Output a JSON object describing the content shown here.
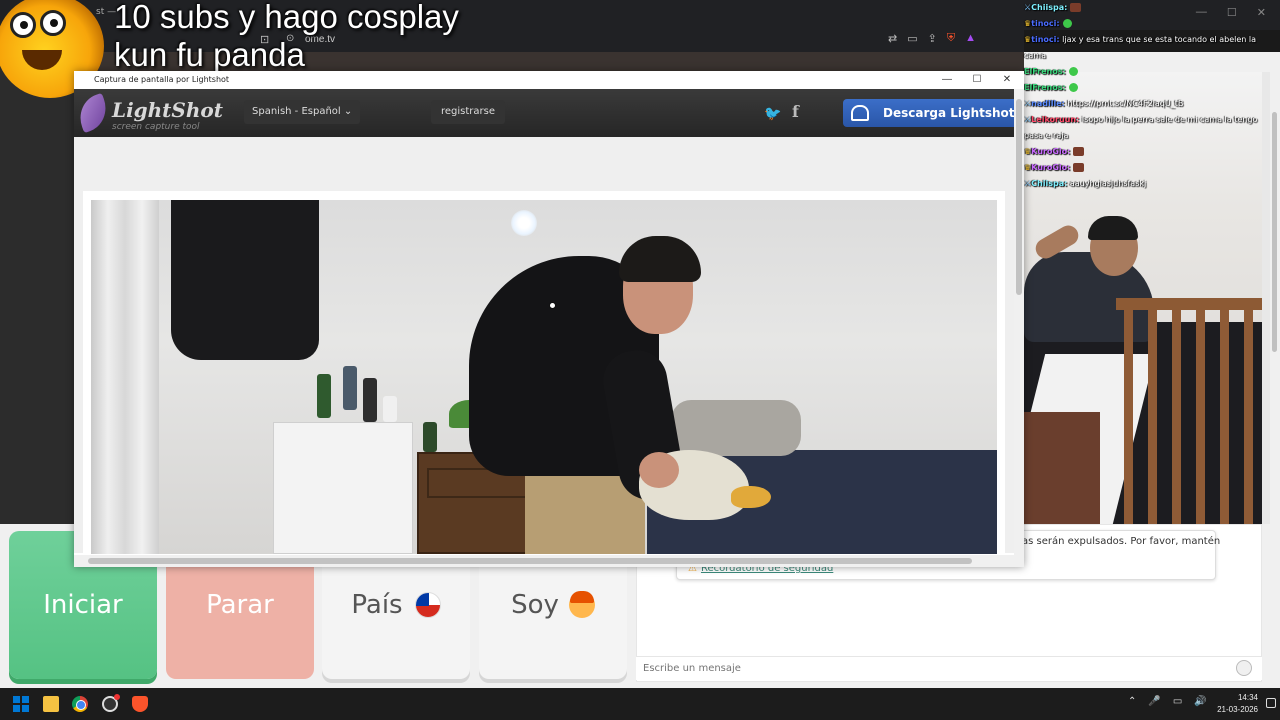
{
  "browser": {
    "tab_text": "st —",
    "url": "ome.tv",
    "window_controls": [
      "—",
      "☐",
      "✕"
    ],
    "address_icons": [
      "⇄",
      "▭",
      "⇪",
      "⋯"
    ]
  },
  "stream_overlay": {
    "title_line1": "10 subs y hago cosplay",
    "title_line2": "kun fu panda"
  },
  "stream_chat": [
    {
      "badge": "⚔",
      "badge_type": "sword",
      "user": "Chiispa:",
      "user_color": "#7ef0ff",
      "text": "",
      "emote": "brown"
    },
    {
      "badge": "♛",
      "badge_type": "crown",
      "user": "tinoci:",
      "user_color": "#4a6cff",
      "text": "",
      "emote": "green"
    },
    {
      "badge": "♛",
      "badge_type": "crown",
      "user": "tinoci:",
      "user_color": "#4a6cff",
      "text": "ljax y esa trans que se esta tocando el abelen la cama",
      "emote": ""
    },
    {
      "badge": "",
      "badge_type": "",
      "user": "ElFrenos:",
      "user_color": "#3ad87c",
      "text": "",
      "emote": "green"
    },
    {
      "badge": "",
      "badge_type": "",
      "user": "ElFrenos:",
      "user_color": "#3ad87c",
      "text": "",
      "emote": "green"
    },
    {
      "badge": "⚔",
      "badge_type": "sword",
      "user": "nadille:",
      "user_color": "#5a8cff",
      "text": "https://prnt.sc/NC4F2iaqU_tB",
      "emote": ""
    },
    {
      "badge": "⚔",
      "badge_type": "sword",
      "user": "Leikoruun:",
      "user_color": "#ff4a6a",
      "text": "isopo hijo la perra sale de mi cama la tengo pasa e raja",
      "emote": ""
    },
    {
      "badge": "♛",
      "badge_type": "crown",
      "user": "KuroGio:",
      "user_color": "#c86aff",
      "text": "",
      "emote": "brown"
    },
    {
      "badge": "♛",
      "badge_type": "crown",
      "user": "KuroGio:",
      "user_color": "#c86aff",
      "text": "",
      "emote": "brown"
    },
    {
      "badge": "⚔",
      "badge_type": "sword",
      "user": "Chiispa:",
      "user_color": "#7ef0ff",
      "text": "aauyhgiasjuhsfaskj",
      "emote": ""
    }
  ],
  "lightshot": {
    "window_title": "Captura de pantalla por Lightshot",
    "window_controls": [
      "—",
      "☐",
      "✕"
    ],
    "logo": "LightShot",
    "tagline": "screen capture tool",
    "language": "Spanish - Español",
    "language_caret": "⌄",
    "register": "registrarse",
    "twitter_icon": "🐦",
    "facebook_icon": "f",
    "download_label": "Descarga Lightshot gratis"
  },
  "ome": {
    "start_label": "Iniciar",
    "stop_label": "Parar",
    "country_label": "País",
    "gender_label": "Soy",
    "notice_text": "as serán expulsados. Por favor, mantén",
    "security_link": "Recordatorio de seguridad",
    "warn_icon": "⚠",
    "message_placeholder": "Escribe un mensaje"
  },
  "taskbar": {
    "tray_icons": [
      "⌃",
      "🎤",
      "▭",
      "🔊"
    ],
    "time": "14:34",
    "date": "21-03-2026"
  },
  "colors": {
    "start_green": "#55c283",
    "stop_salmon": "#eeb1a6",
    "lightshot_blue": "#2a56a8"
  }
}
